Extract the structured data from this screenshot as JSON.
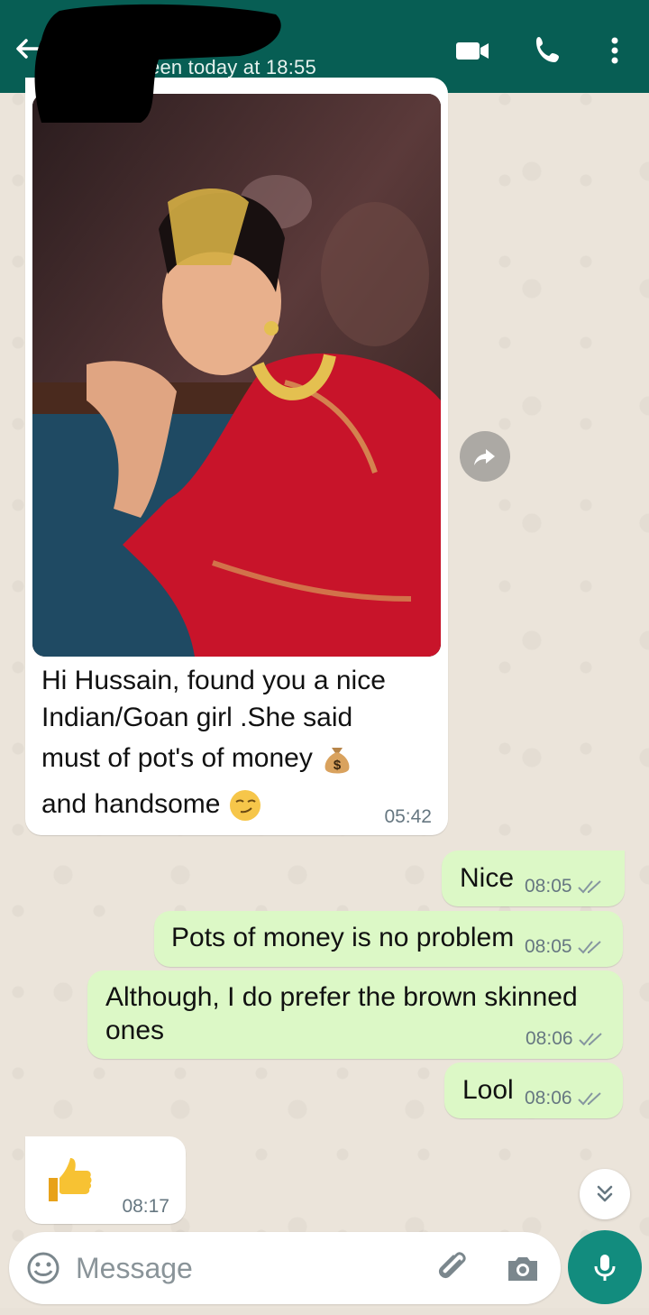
{
  "header": {
    "subtitle": "st seen today at 18:55",
    "icons": [
      "back-arrow-icon",
      "video-call-icon",
      "voice-call-icon",
      "more-options-icon"
    ]
  },
  "messages": [
    {
      "direction": "incoming",
      "has_image": true,
      "caption_lines": [
        "Hi Hussain, found you a nice",
        "Indian/Goan girl .She said",
        "must of pot's of money",
        "and handsome"
      ],
      "emojis": [
        "money-bag-icon",
        "smirking-face-icon"
      ],
      "time": "05:42"
    },
    {
      "direction": "outgoing",
      "text": "Nice",
      "time": "08:05",
      "status": "read-ticks"
    },
    {
      "direction": "outgoing",
      "text": "Pots of money is no problem",
      "time": "08:05",
      "status": "read-ticks"
    },
    {
      "direction": "outgoing",
      "text_lines": [
        "Although, I do prefer the brown skinned",
        "ones"
      ],
      "time": "08:06",
      "status": "read-ticks"
    },
    {
      "direction": "outgoing",
      "text": "Lool",
      "time": "08:06",
      "status": "read-ticks"
    },
    {
      "direction": "incoming",
      "emoji": "thumbs-up-icon",
      "time": "08:17"
    }
  ],
  "composer": {
    "placeholder": "Message",
    "icons": [
      "emoji-icon",
      "attach-icon",
      "camera-icon",
      "mic-icon"
    ]
  },
  "colors": {
    "header": "#075e54",
    "outgoing_bubble": "#dcf8c6",
    "incoming_bubble": "#ffffff",
    "mic_button": "#128c7e"
  }
}
